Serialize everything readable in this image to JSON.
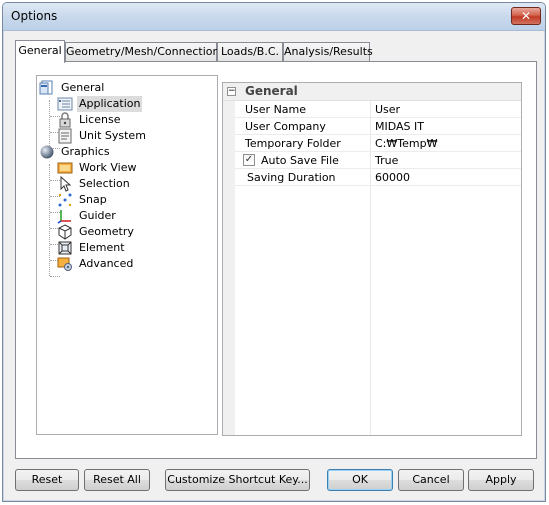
{
  "window": {
    "title": "Options",
    "close_glyph": "✕"
  },
  "tabs": [
    {
      "label": "General",
      "active": true
    },
    {
      "label": "Geometry/Mesh/Connections",
      "active": false
    },
    {
      "label": "Loads/B.C.",
      "active": false
    },
    {
      "label": "Analysis/Results",
      "active": false
    }
  ],
  "tree": {
    "groups": [
      {
        "label": "General",
        "icon": "general-options-icon",
        "items": [
          {
            "label": "Application",
            "icon": "application-icon",
            "selected": true
          },
          {
            "label": "License",
            "icon": "license-lock-icon"
          },
          {
            "label": "Unit System",
            "icon": "unit-system-icon"
          }
        ]
      },
      {
        "label": "Graphics",
        "icon": "graphics-sphere-icon",
        "items": [
          {
            "label": "Work View",
            "icon": "work-view-icon"
          },
          {
            "label": "Selection",
            "icon": "selection-cursor-icon"
          },
          {
            "label": "Snap",
            "icon": "snap-icon"
          },
          {
            "label": "Guider",
            "icon": "guider-axes-icon"
          },
          {
            "label": "Geometry",
            "icon": "geometry-cube-icon"
          },
          {
            "label": "Element",
            "icon": "element-icon"
          },
          {
            "label": "Advanced",
            "icon": "advanced-icon"
          }
        ]
      }
    ]
  },
  "properties": {
    "section_label": "General",
    "collapse_glyph": "⊟",
    "rows": [
      {
        "name": "User Name",
        "value": "User"
      },
      {
        "name": "User Company",
        "value": "MIDAS IT"
      },
      {
        "name": "Temporary Folder",
        "value": "C:₩Temp₩"
      },
      {
        "name": "Auto Save File",
        "value": "True",
        "checkbox": true,
        "checked": true,
        "check_glyph": "✓"
      },
      {
        "name": "Saving Duration",
        "value": "60000"
      }
    ]
  },
  "buttons": {
    "reset": "Reset",
    "reset_all": "Reset All",
    "customize_shortcut": "Customize Shortcut Key...",
    "ok": "OK",
    "cancel": "Cancel",
    "apply": "Apply"
  }
}
